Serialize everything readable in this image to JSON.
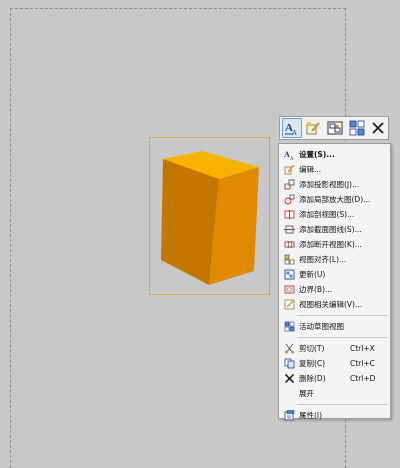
{
  "toolbar": {
    "buttons": [
      {
        "icon": "text-settings-icon"
      },
      {
        "icon": "edit-icon"
      },
      {
        "icon": "view-icon"
      },
      {
        "icon": "grid-view-icon"
      },
      {
        "icon": "close-icon"
      }
    ]
  },
  "menu": {
    "items": [
      {
        "icon": "settings-icon",
        "label": "设置(S)...",
        "bold": true
      },
      {
        "icon": "edit-icon",
        "label": "编辑..."
      },
      {
        "icon": "projection-view-icon",
        "label": "添加投影视图(J)..."
      },
      {
        "icon": "detail-view-icon",
        "label": "添加局部放大图(D)..."
      },
      {
        "icon": "cut-view-icon",
        "label": "添加剖视图(S)..."
      },
      {
        "icon": "section-line-icon",
        "label": "添加截面图线(S)..."
      },
      {
        "icon": "break-view-icon",
        "label": "添加断开视图(K)..."
      },
      {
        "icon": "align-view-icon",
        "label": "视图对齐(L)..."
      },
      {
        "icon": "update-icon",
        "label": "更新(U)"
      },
      {
        "icon": "boundary-icon",
        "label": "边界(B)..."
      },
      {
        "icon": "view-edit-icon",
        "label": "视图相关编辑(V)..."
      },
      {
        "icon": "active-sketch-view-icon",
        "label": "活动草图视图"
      },
      {
        "icon": "cut-icon",
        "label": "剪切(T)",
        "shortcut": "Ctrl+X"
      },
      {
        "icon": "copy-icon",
        "label": "复制(C)",
        "shortcut": "Ctrl+C"
      },
      {
        "icon": "delete-icon",
        "label": "删除(D)",
        "shortcut": "Ctrl+D"
      },
      {
        "icon": "",
        "label": "展开"
      },
      {
        "icon": "properties-icon",
        "label": "属性(I)"
      }
    ]
  },
  "colors": {
    "part_top": "#f5b400",
    "part_left": "#c27700",
    "part_right": "#e08a00",
    "frame": "#e8a040",
    "background": "#c8c8c8"
  }
}
